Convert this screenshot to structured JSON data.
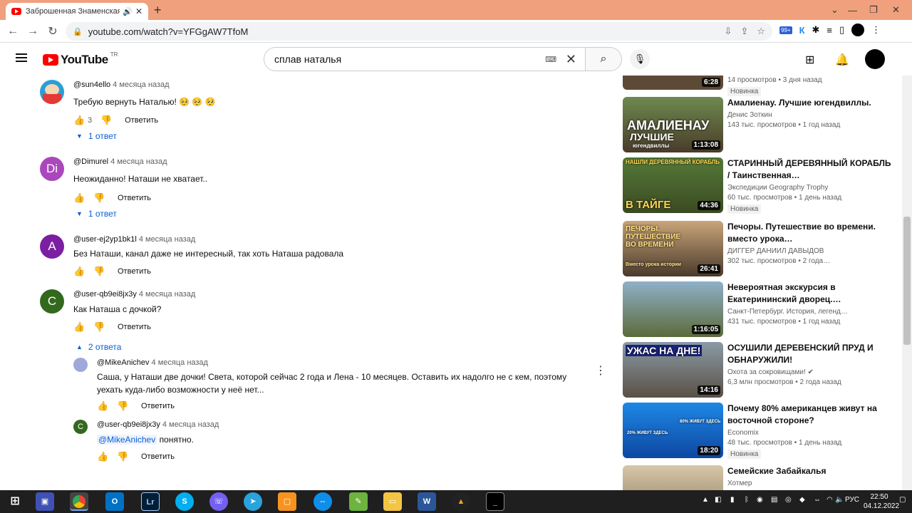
{
  "browser": {
    "tab_title": "Заброшенная Знаменская ц",
    "tab_close": "✕",
    "new_tab": "+",
    "url": "youtube.com/watch?v=YFGgAW7TfoM",
    "ext_badge": "99+"
  },
  "yt": {
    "logo": "YouTube",
    "country": "TR",
    "search_value": "сплав наталья"
  },
  "comments": [
    {
      "author": "@sun4ello",
      "time": "4 месяца назад",
      "text": "Требую вернуть Наталью! 🥺 🥺 🥺",
      "likes": "3",
      "reply": "Ответить",
      "replies": "1 ответ",
      "avatar_color": "#2a9fd6",
      "initial": ""
    },
    {
      "author": "@Dimurel",
      "time": "4 месяца назад",
      "text": "Неожиданно! Наташи не хватает..",
      "likes": "",
      "reply": "Ответить",
      "replies": "1 ответ",
      "avatar_color": "#ab47bc",
      "initial": "Di"
    },
    {
      "author": "@user-ej2yp1bk1l",
      "time": "4 месяца назад",
      "text": "Без Наташи, канал даже не интересный, так хоть Наташа радовала",
      "likes": "",
      "reply": "Ответить",
      "avatar_color": "#7b1fa2",
      "initial": "A"
    },
    {
      "author": "@user-qb9ei8jx3y",
      "time": "4 месяца назад",
      "text": "Как Наташа с дочкой?",
      "likes": "",
      "reply": "Ответить",
      "replies": "2 ответа",
      "avatar_color": "#33691e",
      "initial": "C"
    }
  ],
  "replies": [
    {
      "author": "@MikeAnichev",
      "time": "4 месяца назад",
      "text": "Саша, у Наташи две дочки! Света, которой сейчас 2 года и Лена - 10 месяцев. Оставить их надолго не с кем, поэтому уехать куда-либо возможности у неё нет...",
      "reply": "Ответить"
    },
    {
      "author": "@user-qb9ei8jx3y",
      "time": "4 месяца назад",
      "mention": "@MikeAnichev",
      "text": "понятно.",
      "reply": "Ответить",
      "initial": "C"
    }
  ],
  "sidebar": [
    {
      "title": "",
      "channel": "",
      "stats": "14 просмотров • 3 дня назад",
      "duration": "6:28",
      "badge": "Новинка"
    },
    {
      "title": "Амалиенау. Лучшие югендвиллы.",
      "channel": "Денис Зоткин",
      "stats": "143 тыс. просмотров • 1 год назад",
      "duration": "1:13:08",
      "overlay": "АМАЛИЕНАУ",
      "overlay2": "ЛУЧШИЕ",
      "overlay3": "югендвиллы"
    },
    {
      "title": "СТАРИННЫЙ ДЕРЕВЯННЫЙ КОРАБЛЬ / Таинственная…",
      "channel": "Экспедиции Geography Trophy",
      "stats": "60 тыс. просмотров • 1 день назад",
      "duration": "44:36",
      "badge": "Новинка",
      "overlay": "НАШЛИ ДЕРЕВЯННЫЙ КОРАБЛЬ",
      "overlay2": "В ТАЙГЕ"
    },
    {
      "title": "Печоры. Путешествие во времени. вместо урока…",
      "channel": "ДИГГЕР ДАНИИЛ ДАВЫДОВ",
      "stats": "302 тыс. просмотров • 2 года…",
      "duration": "26:41",
      "overlay": "ПЕЧОРЫ. ПУТЕШЕСТВИЕ ВО ВРЕМЕНИ",
      "overlay2": "Вместо урока истории"
    },
    {
      "title": "Невероятная экскурсия в Екатерининский дворец.…",
      "channel": "Санкт-Петербург. История, легенд…",
      "stats": "431 тыс. просмотров • 1 год назад",
      "duration": "1:16:05"
    },
    {
      "title": "ОСУШИЛИ ДЕРЕВЕНСКИЙ ПРУД И ОБНАРУЖИЛИ!",
      "channel": "Охота за сокровищами!",
      "verified": "✔",
      "stats": "6,3 млн просмотров • 2 года назад",
      "duration": "14:16",
      "overlay": "УЖАС НА ДНЕ!"
    },
    {
      "title": "Почему 80% американцев живут на восточной стороне?",
      "channel": "Economix",
      "stats": "48 тыс. просмотров • 1 день назад",
      "duration": "18:20",
      "badge": "Новинка",
      "overlay": "80% ЖИВУТ ЗДЕСЬ",
      "overlay2": "20% ЖИВУТ ЗДЕСЬ"
    },
    {
      "title": "Семейские Забайкалья",
      "channel": "Хотмер",
      "stats": "",
      "duration": ""
    }
  ],
  "taskbar": {
    "lang": "РУС",
    "time": "22:50",
    "date": "04.12.2022"
  }
}
